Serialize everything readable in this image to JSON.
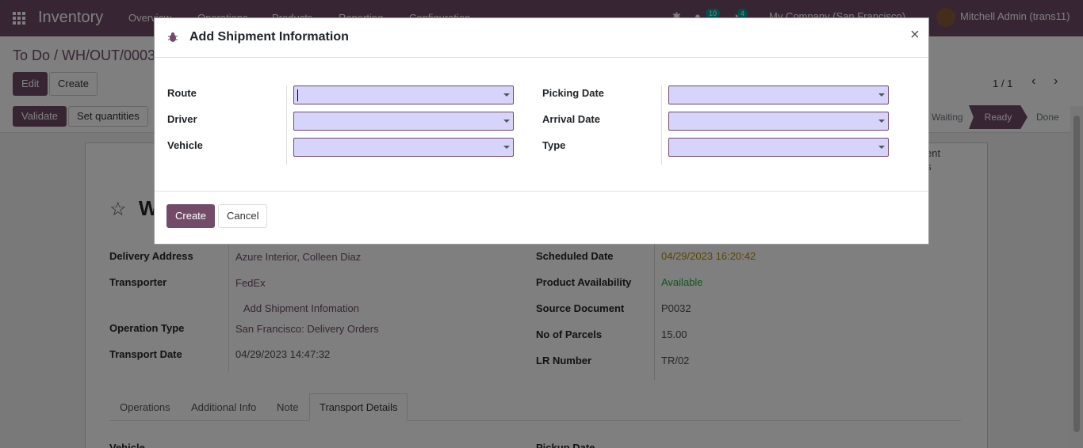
{
  "navbar": {
    "app_name": "Inventory",
    "menu": [
      "Overview",
      "Operations",
      "Products",
      "Reporting",
      "Configuration"
    ],
    "messages_count": "10",
    "activities_count": "4",
    "company": "My Company (San Francisco)",
    "user": "Mitchell Admin (trans11)"
  },
  "control": {
    "breadcrumb": "To Do / WH/OUT/0003",
    "edit_label": "Edit",
    "create_label": "Create",
    "validate_label": "Validate",
    "set_quantities_label": "Set quantities",
    "pager": "1 / 1",
    "status_waiting": "Waiting",
    "status_ready": "Ready",
    "status_done": "Done"
  },
  "sheet": {
    "title_fragment": "W",
    "smart_button_fragment_1": "pment",
    "smart_button_fragment_2": "ates",
    "left_fields": [
      {
        "label": "Delivery Address",
        "value": "Azure Interior, Colleen Diaz"
      },
      {
        "label": "Transporter",
        "value": "FedEx"
      },
      {
        "label": "Operation Type",
        "value": "San Francisco: Delivery Orders"
      },
      {
        "label": "Transport Date",
        "value": "04/29/2023 14:47:32"
      }
    ],
    "add_shipment_link": "Add Shipment Infomation",
    "right_fields": [
      {
        "label": "Scheduled Date",
        "value": "04/29/2023 16:20:42"
      },
      {
        "label": "Product Availability",
        "value": "Available"
      },
      {
        "label": "Source Document",
        "value": "P0032"
      },
      {
        "label": "No of Parcels",
        "value": "15.00"
      },
      {
        "label": "LR Number",
        "value": "TR/02"
      }
    ],
    "tabs": [
      "Operations",
      "Additional Info",
      "Note",
      "Transport Details"
    ],
    "bottom_label_left": "Vehicle",
    "bottom_label_right": "Pickup Date",
    "colors": {
      "scheduled": "#b8860b",
      "available": "#28a745",
      "link": "#714b67"
    }
  },
  "modal": {
    "title": "Add Shipment Information",
    "close_glyph": "×",
    "left_labels": [
      "Route",
      "Driver",
      "Vehicle"
    ],
    "right_labels": [
      "Picking Date",
      "Arrival Date",
      "Type"
    ],
    "create_label": "Create",
    "cancel_label": "Cancel"
  }
}
